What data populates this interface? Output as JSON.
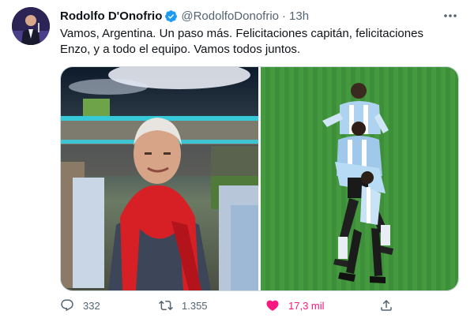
{
  "author": {
    "name": "Rodolfo D'Onofrio",
    "handle": "@RodolfoDonofrio",
    "separator": "·",
    "time": "13h",
    "verified": true
  },
  "tweet": {
    "text": "Vamos, Argentina. Un paso más. Felicitaciones capitán, felicitaciones Enzo, y a todo el equipo. Vamos todos juntos."
  },
  "media": {
    "count": 2
  },
  "actions": {
    "replies": "332",
    "retweets": "1.355",
    "likes": "17,3 mil",
    "liked": true
  },
  "icons": {
    "verified": "verified-badge-icon",
    "more": "more-horizontal-icon",
    "reply": "reply-icon",
    "retweet": "retweet-icon",
    "like": "heart-icon",
    "share": "share-icon"
  },
  "colors": {
    "verified": "#1d9bf0",
    "secondary_text": "#536471",
    "like": "#f91880",
    "border": "#cfd9de"
  }
}
